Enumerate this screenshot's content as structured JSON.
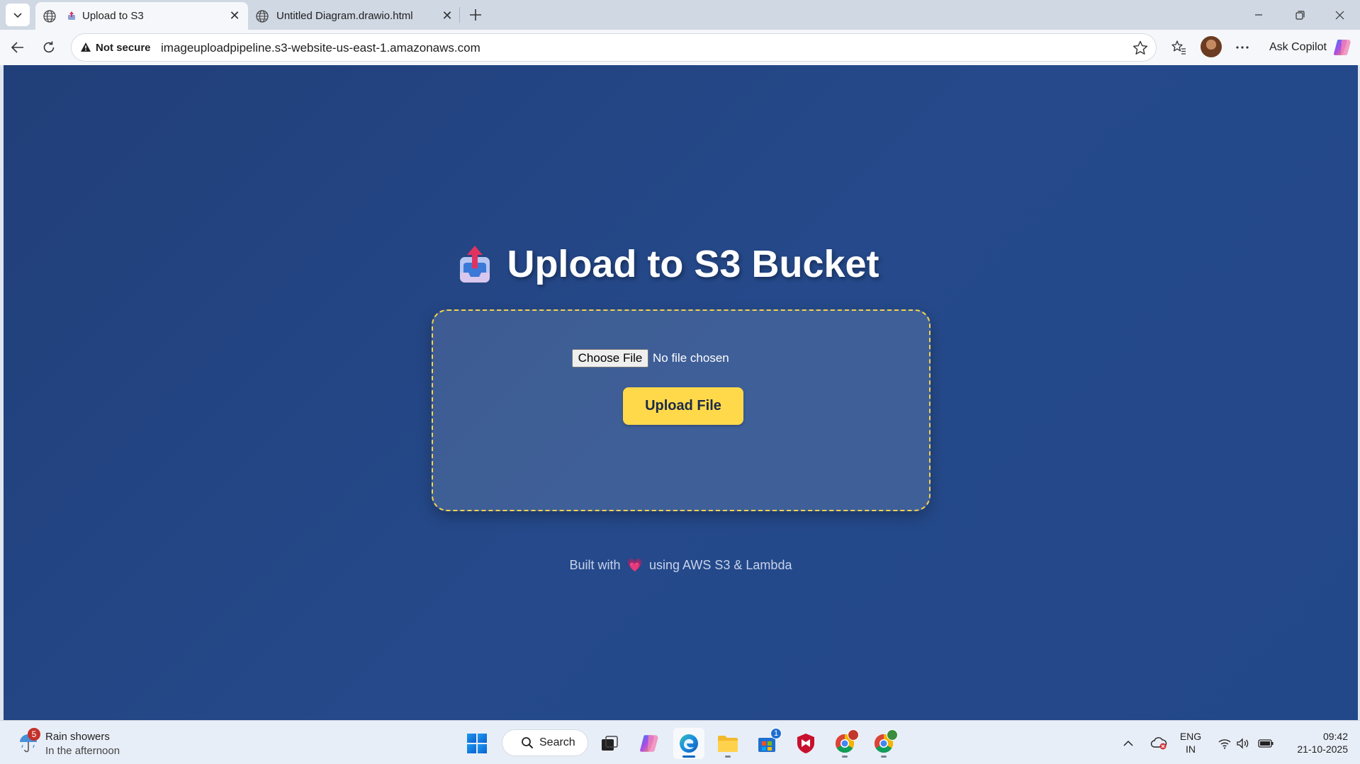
{
  "browser": {
    "tabs": [
      {
        "title": "Upload to S3",
        "active": true
      },
      {
        "title": "Untitled Diagram.drawio.html",
        "active": false
      }
    ],
    "security_label": "Not secure",
    "url": "imageuploadpipeline.s3-website-us-east-1.amazonaws.com",
    "copilot_label": "Ask Copilot"
  },
  "page": {
    "title": "Upload to S3 Bucket",
    "file_input": {
      "button_label": "Choose File",
      "status": "No file chosen"
    },
    "upload_button_label": "Upload File",
    "footer": {
      "prefix": "Built with",
      "heart": "💗",
      "suffix": "using AWS S3 & Lambda"
    },
    "colors": {
      "background": "#23468a",
      "accent": "#ffd94a",
      "card_border": "#f5d34f"
    }
  },
  "taskbar": {
    "weather": {
      "badge": "5",
      "title": "Rain showers",
      "subtitle": "In the afternoon"
    },
    "search_label": "Search",
    "store_badge": "1",
    "language": {
      "line1": "ENG",
      "line2": "IN"
    },
    "clock": {
      "time": "09:42",
      "date": "21-10-2025"
    }
  }
}
